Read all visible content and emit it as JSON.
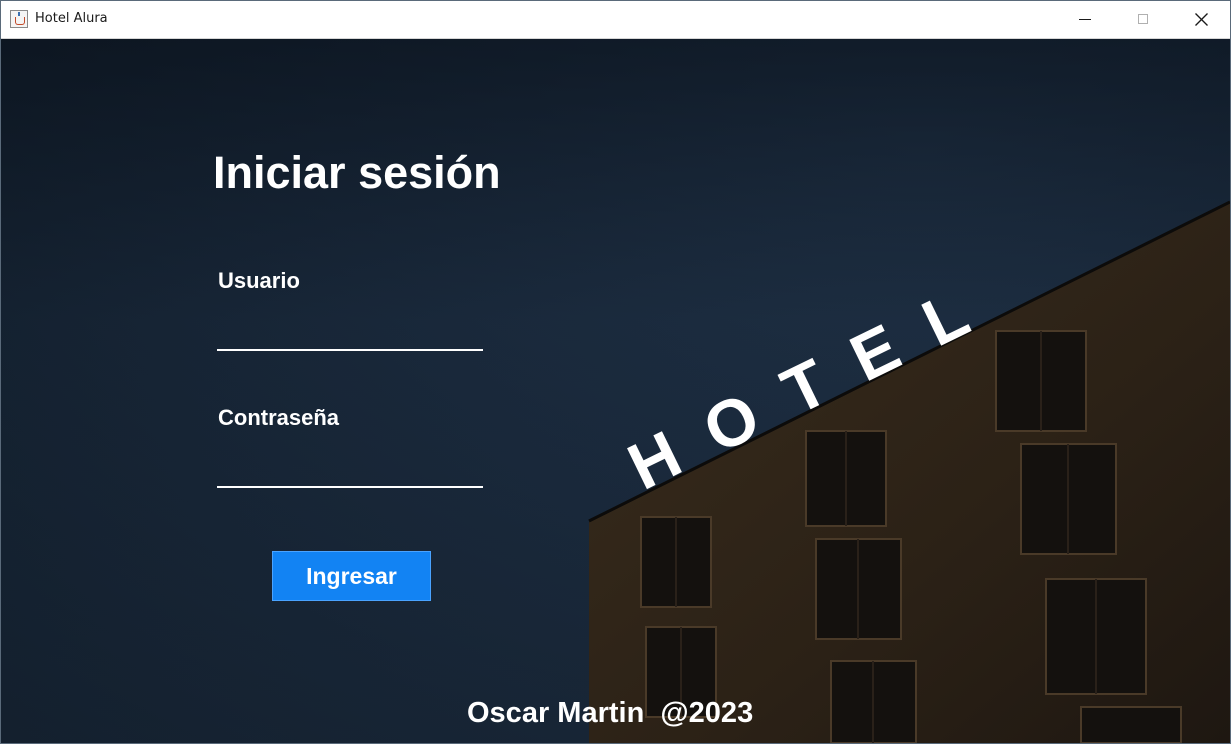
{
  "window": {
    "title": "Hotel Alura"
  },
  "login": {
    "heading": "Iniciar sesión",
    "username_label": "Usuario",
    "username_value": "",
    "password_label": "Contraseña",
    "password_value": "",
    "submit_label": "Ingresar"
  },
  "background": {
    "sign_text": "HOTEL"
  },
  "footer": {
    "credit": "Oscar Martin  @2023"
  },
  "colors": {
    "accent": "#1283f3",
    "sky": "#1b2a3a",
    "building": "#2e2418",
    "text": "#ffffff"
  }
}
